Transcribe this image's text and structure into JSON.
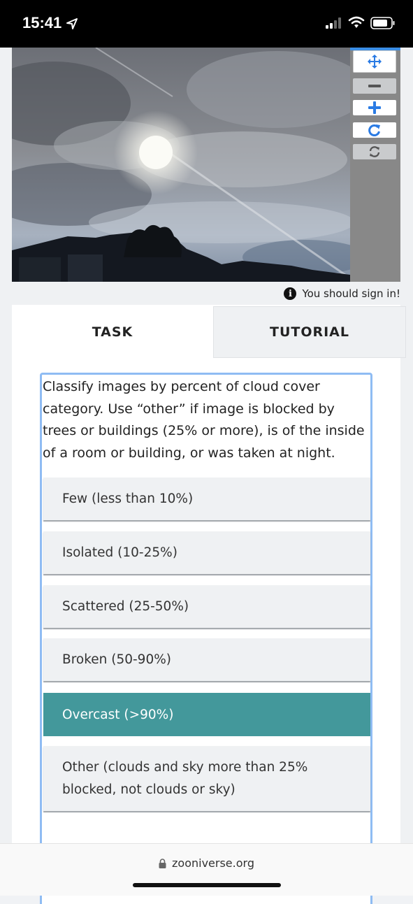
{
  "status_bar": {
    "time": "15:41"
  },
  "toolbar": {
    "tools": [
      {
        "name": "move-tool-button",
        "icon": "move-icon"
      },
      {
        "name": "zoom-out-button",
        "icon": "minus-icon"
      },
      {
        "name": "zoom-in-button",
        "icon": "plus-icon"
      },
      {
        "name": "rotate-button",
        "icon": "rotate-icon"
      },
      {
        "name": "reset-button",
        "icon": "reset-icon"
      }
    ]
  },
  "signin": {
    "text": "You should sign in!"
  },
  "tabs": {
    "task": "TASK",
    "tutorial": "TUTORIAL"
  },
  "task": {
    "instructions": "Classify images by percent of cloud cover category. Use “other” if image is blocked by trees or buildings (25% or more), is of the inside of a room or building, or was taken at night.",
    "answers": [
      {
        "label": "Few (less than 10%)",
        "selected": false
      },
      {
        "label": "Isolated (10-25%)",
        "selected": false
      },
      {
        "label": "Scattered (25-50%)",
        "selected": false
      },
      {
        "label": "Broken (50-90%)",
        "selected": false
      },
      {
        "label": "Overcast (>90%)",
        "selected": true
      },
      {
        "label": "Other (clouds and sky more than 25% blocked, not clouds or sky)",
        "selected": false
      }
    ]
  },
  "browser": {
    "url": "zooniverse.org"
  },
  "colors": {
    "selected_answer": "#43989b",
    "task_border": "#8fbcf3",
    "tool_icon_blue": "#2a7be4"
  }
}
